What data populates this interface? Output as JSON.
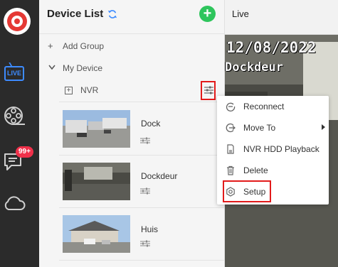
{
  "sidebar": {
    "live_label": "LIVE",
    "message_badge": "99+"
  },
  "device_list": {
    "title": "Device List",
    "add_group_label": "Add Group",
    "my_device_label": "My Device",
    "nvr_label": "NVR",
    "devices": [
      {
        "name": "Dock"
      },
      {
        "name": "Dockdeur"
      },
      {
        "name": "Huis"
      }
    ]
  },
  "live": {
    "title": "Live",
    "osd_date": "12/08/2022",
    "osd_camera": "Dockdeur"
  },
  "context_menu": {
    "items": [
      {
        "label": "Reconnect",
        "icon": "reconnect-icon"
      },
      {
        "label": "Move To",
        "icon": "move-icon"
      },
      {
        "label": "NVR HDD Playback",
        "icon": "sd-card-icon"
      },
      {
        "label": "Delete",
        "icon": "trash-icon"
      },
      {
        "label": "Setup",
        "icon": "gear-icon"
      }
    ]
  },
  "colors": {
    "accent_blue": "#3d8bff",
    "add_green": "#2ec55c",
    "highlight_red": "#e21b1b",
    "badge_red": "#f0304a",
    "rail_dark": "#2b2b2b"
  }
}
